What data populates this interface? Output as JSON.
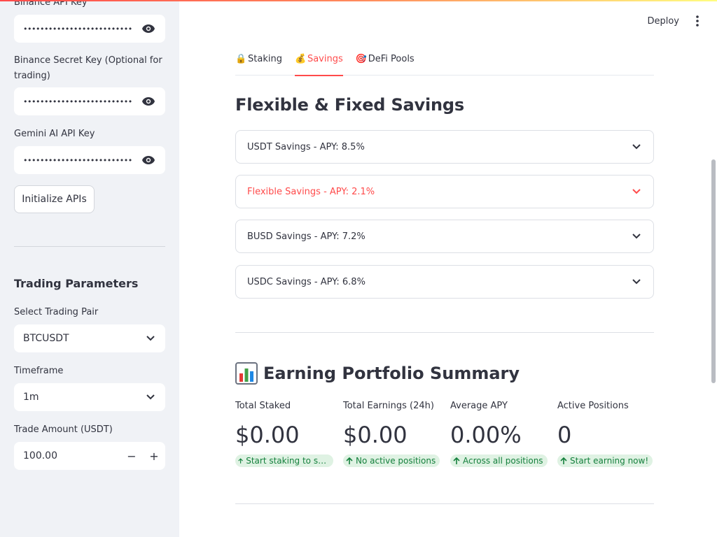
{
  "sidebar": {
    "binance_api_key_label": "Binance API Key",
    "binance_api_key_value": "••••••••••••••••••••••••••••••••••••",
    "binance_secret_label": "Binance Secret Key (Optional for trading)",
    "binance_secret_value": "••••••••••••••••••••••••••••••••••••",
    "gemini_label": "Gemini AI API Key",
    "gemini_value": "••••••••••••••••••••••••••••••••••••",
    "init_button": "Initialize APIs",
    "trading_heading": "Trading Parameters",
    "pair_label": "Select Trading Pair",
    "pair_value": "BTCUSDT",
    "timeframe_label": "Timeframe",
    "timeframe_value": "1m",
    "amount_label": "Trade Amount (USDT)",
    "amount_value": "100.00",
    "minus": "−",
    "plus": "+"
  },
  "header": {
    "deploy_label": "Deploy"
  },
  "tabs": [
    {
      "icon": "🔒",
      "label": "Staking"
    },
    {
      "icon": "💰",
      "label": "Savings"
    },
    {
      "icon": "🎯",
      "label": "DeFi Pools"
    }
  ],
  "savings": {
    "heading": "Flexible & Fixed Savings",
    "items": [
      {
        "label": "USDT Savings - APY: 8.5%"
      },
      {
        "label": "Flexible Savings - APY: 2.1%"
      },
      {
        "label": "BUSD Savings - APY: 7.2%"
      },
      {
        "label": "USDC Savings - APY: 6.8%"
      }
    ]
  },
  "summary": {
    "heading": "Earning Portfolio Summary",
    "metrics": [
      {
        "label": "Total Staked",
        "value": "$0.00",
        "delta": "Start staking to see returns"
      },
      {
        "label": "Total Earnings (24h)",
        "value": "$0.00",
        "delta": "No active positions"
      },
      {
        "label": "Average APY",
        "value": "0.00%",
        "delta": "Across all positions"
      },
      {
        "label": "Active Positions",
        "value": "0",
        "delta": "Start earning now!"
      }
    ]
  },
  "colors": {
    "accent": "#ff4b4b",
    "delta_bg": "#dff2e3",
    "delta_fg": "#15803d",
    "sidebar_bg": "#f0f2f6"
  }
}
